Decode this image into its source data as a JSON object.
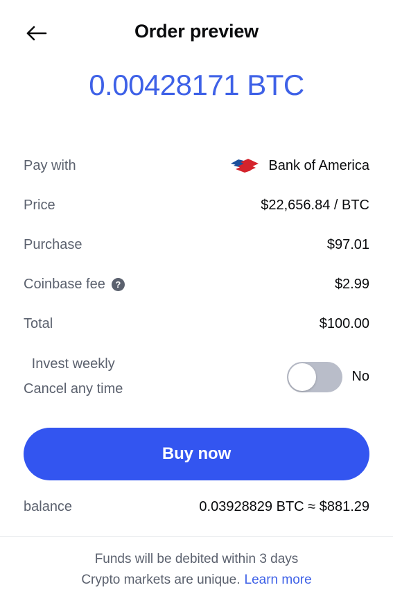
{
  "header": {
    "back_icon": "arrow-left-icon",
    "title": "Order preview"
  },
  "amount": {
    "value": "0.00428171 BTC",
    "color": "#3e61e7"
  },
  "details": [
    {
      "label": "Pay with",
      "value": "Bank of America",
      "icon": "bank-of-america-logo"
    },
    {
      "label": "Price",
      "value": "$22,656.84 / BTC"
    },
    {
      "label": "Purchase",
      "value": "$97.01"
    },
    {
      "label": "Coinbase fee",
      "value": "$2.99",
      "help_icon": "question-mark-icon",
      "help_glyph": "?"
    },
    {
      "label": "Total",
      "value": "$100.00"
    }
  ],
  "recurring": {
    "label_line1": "Invest weekly",
    "label_line2": "Cancel any time",
    "toggle_state": "No",
    "toggle_on": false,
    "track_color": "#b9bdc9"
  },
  "primary_action": {
    "label": "Buy now",
    "color": "#3355f0"
  },
  "balance": {
    "label": "balance",
    "value": "0.03928829 BTC ≈ $881.29"
  },
  "footer": {
    "line1": "Funds will be debited within 3 days",
    "line2": "Crypto markets are unique.",
    "link": "Learn more",
    "link_color": "#3e61e7"
  }
}
